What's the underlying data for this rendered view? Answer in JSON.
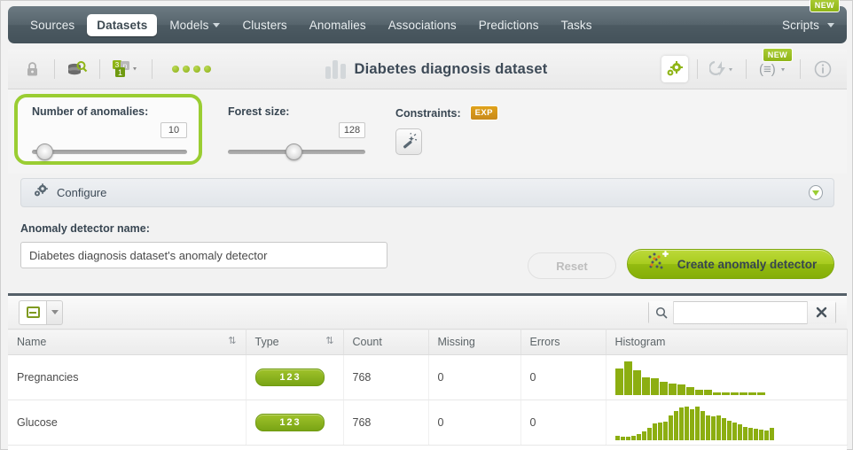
{
  "nav": {
    "items": [
      {
        "label": "Sources",
        "active": false,
        "caret": false
      },
      {
        "label": "Datasets",
        "active": true,
        "caret": false
      },
      {
        "label": "Models",
        "active": false,
        "caret": true
      },
      {
        "label": "Clusters",
        "active": false,
        "caret": false
      },
      {
        "label": "Anomalies",
        "active": false,
        "caret": false
      },
      {
        "label": "Associations",
        "active": false,
        "caret": false
      },
      {
        "label": "Predictions",
        "active": false,
        "caret": false
      },
      {
        "label": "Tasks",
        "active": false,
        "caret": false
      }
    ],
    "scripts_label": "Scripts",
    "new_badge": "NEW"
  },
  "toolbar": {
    "lock_icon": "lock-icon",
    "source_icon": "dataset-search-icon",
    "fields_icon": "field-types-icon",
    "status_dots": 4,
    "title": "Diabetes diagnosis dataset",
    "config_icon": "gears-icon",
    "flash_icon": "flash-icon",
    "list_icon": "list-format-icon",
    "info_icon": "info-icon",
    "new_badge": "NEW"
  },
  "params": {
    "anomalies": {
      "label": "Number of anomalies:",
      "value": "10",
      "knob_pct": 3,
      "highlighted": true
    },
    "forest": {
      "label": "Forest size:",
      "value": "128",
      "knob_pct": 48,
      "highlighted": false
    },
    "constraints": {
      "label": "Constraints:",
      "badge": "EXP",
      "button_icon": "magic-wand-icon"
    }
  },
  "configure": {
    "label": "Configure",
    "icon": "gears-icon",
    "expand_icon": "chevron-down-icon"
  },
  "name_section": {
    "label": "Anomaly detector name:",
    "value": "Diabetes diagnosis dataset's anomaly detector",
    "placeholder": "Anomaly detector name",
    "reset_label": "Reset",
    "create_label": "Create anomaly detector",
    "create_icon": "anomaly-scatter-icon"
  },
  "table": {
    "collapse_icon": "collapse-icon",
    "dropdown_icon": "chevron-down-icon",
    "search_icon": "search-icon",
    "clear_icon": "close-icon",
    "search_value": "",
    "search_placeholder": "",
    "columns": [
      "Name",
      "Type",
      "Count",
      "Missing",
      "Errors",
      "Histogram"
    ],
    "sortable": [
      "Name",
      "Type"
    ],
    "rows": [
      {
        "name": "Pregnancies",
        "type": "123",
        "count": "768",
        "missing": "0",
        "errors": "0",
        "histogram": [
          68,
          86,
          64,
          46,
          42,
          34,
          30,
          28,
          20,
          14,
          13,
          7,
          7,
          7,
          7,
          7,
          7
        ]
      },
      {
        "name": "Glucose",
        "type": "123",
        "count": "768",
        "missing": "0",
        "errors": "0",
        "histogram": [
          10,
          8,
          8,
          12,
          16,
          22,
          30,
          42,
          44,
          46,
          62,
          74,
          82,
          84,
          78,
          84,
          72,
          62,
          60,
          62,
          56,
          48,
          44,
          40,
          34,
          30,
          28,
          26,
          24,
          30
        ]
      }
    ]
  },
  "colors": {
    "accent_green": "#93bb10",
    "highlight_green": "#9acd32",
    "nav_dark": "#4c5a62",
    "exp_orange": "#c8891a",
    "text_dark": "#384652"
  },
  "chart_data": [
    {
      "type": "bar",
      "title": "Pregnancies",
      "categories": [
        "0",
        "1",
        "2",
        "3",
        "4",
        "5",
        "6",
        "7",
        "8",
        "9",
        "10",
        "11",
        "12",
        "13",
        "14",
        "15",
        "16"
      ],
      "values": [
        68,
        86,
        64,
        46,
        42,
        34,
        30,
        28,
        20,
        14,
        13,
        7,
        7,
        7,
        7,
        7,
        7
      ],
      "xlabel": "",
      "ylabel": "",
      "grid": false,
      "legend": "none"
    },
    {
      "type": "bar",
      "title": "Glucose",
      "categories": [
        "1",
        "2",
        "3",
        "4",
        "5",
        "6",
        "7",
        "8",
        "9",
        "10",
        "11",
        "12",
        "13",
        "14",
        "15",
        "16",
        "17",
        "18",
        "19",
        "20",
        "21",
        "22",
        "23",
        "24",
        "25",
        "26",
        "27",
        "28",
        "29",
        "30"
      ],
      "values": [
        10,
        8,
        8,
        12,
        16,
        22,
        30,
        42,
        44,
        46,
        62,
        74,
        82,
        84,
        78,
        84,
        72,
        62,
        60,
        62,
        56,
        48,
        44,
        40,
        34,
        30,
        28,
        26,
        24,
        30
      ],
      "xlabel": "",
      "ylabel": "",
      "grid": false,
      "legend": "none"
    }
  ]
}
